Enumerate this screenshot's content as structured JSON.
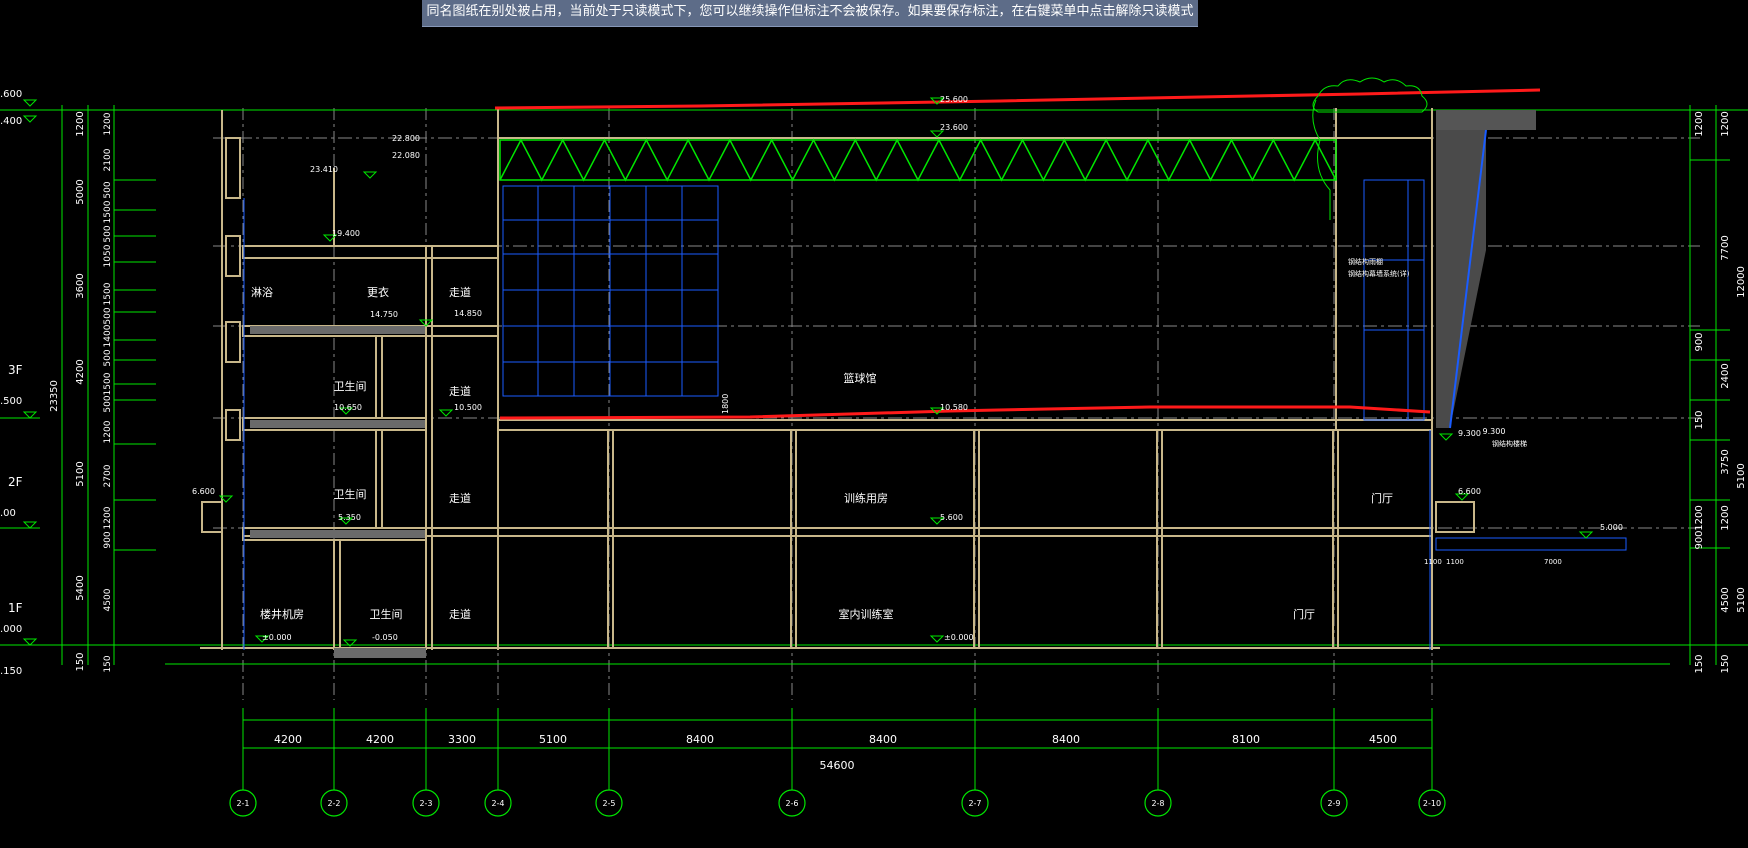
{
  "banner": {
    "text": "同名图纸在别处被占用，当前处于只读模式下，您可以继续操作但标注不会被保存。如果要保存标注，在右键菜单中点击解除只读模式"
  },
  "colors": {
    "green": "#00e600",
    "red": "#ff1a1a",
    "blue": "#1a5cff",
    "tan": "#c8b78a",
    "white": "#ffffff",
    "banner_bg": "#5d6c88"
  },
  "floor_labels": {
    "f3": "3F",
    "f2": "2F",
    "f1": "1F"
  },
  "left_partial_elevations": [
    ".600",
    ".400",
    ".500",
    ".00",
    ".000",
    ".150"
  ],
  "left_dims_outer": [
    "1200",
    "5000",
    "3600",
    "4200",
    "5100",
    "5400",
    "150"
  ],
  "left_dims_inner": [
    "1200",
    "2100",
    "500",
    "1500",
    "500",
    "1050",
    "1500",
    "500",
    "1400",
    "500",
    "1500",
    "500",
    "1200",
    "2700",
    "1200",
    "900",
    "4500",
    "150"
  ],
  "left_total": "23350",
  "right_dims_outer": [
    "1200",
    "7700",
    "2400",
    "9.300",
    "3750",
    "1200",
    "4500",
    "150"
  ],
  "right_dims_inner": [
    "1200",
    "900",
    "150",
    "900",
    "1200",
    "150"
  ],
  "right_edge_partials": [
    "12000",
    "5100",
    "5100"
  ],
  "grid_labels": [
    "2-1",
    "2-2",
    "2-3",
    "2-4",
    "2-5",
    "2-6",
    "2-7",
    "2-8",
    "2-9",
    "2-10"
  ],
  "span_dims": [
    "4200",
    "4200",
    "3300",
    "5100",
    "8400",
    "8400",
    "8400",
    "8100",
    "4500"
  ],
  "total_span": "54600",
  "levels": {
    "top_roof": "25.600",
    "truss_top": "23.600",
    "l_upper1": "23.410",
    "l_upper2": "22.800",
    "l_upper3": "22.080",
    "l_mid": "19.400",
    "stair_l": "14.750",
    "stair_r": "14.850",
    "l_105a": "10.650",
    "l_105b": "10.500",
    "l_105c": "10.580",
    "l_535": "5.350",
    "l_5": "5.600",
    "l_66l": "6.600",
    "l_66r": "6.600",
    "l_5r": "5.000",
    "l_0": "±0.000",
    "l_neg": "-0.050",
    "l_0b": "±0.000",
    "l_93": "9.300",
    "l_1800": "1800"
  },
  "rooms": {
    "r_linyu": "淋浴",
    "r_gengyi": "更衣",
    "r_zoudao1": "走道",
    "r_wsj1": "卫生间",
    "r_zoudao2": "走道",
    "r_lanqiu": "篮球馆",
    "r_wsj2": "卫生间",
    "r_zoudao3": "走道",
    "r_xunlian": "训练用房",
    "r_menting1": "门厅",
    "r_loujing": "楼井机房",
    "r_wsj3": "卫生间",
    "r_zoudao4": "走道",
    "r_shinei": "室内训练室",
    "r_menting2": "门厅"
  },
  "notes": {
    "note1": "钢结构雨棚",
    "note2": "钢结构幕墙系统(详)",
    "note3": "钢结构楼梯",
    "dim_right1": "1100",
    "dim_right2": "7000",
    "dim_right3": "1100"
  }
}
